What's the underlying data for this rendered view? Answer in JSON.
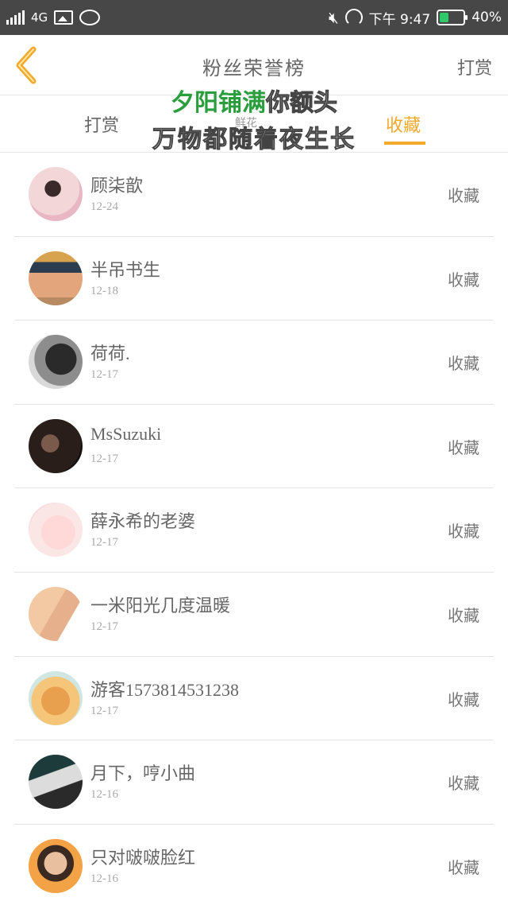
{
  "status_bar": {
    "network": "4G",
    "time": "下午 9:47",
    "battery": "40%",
    "battery_level": 0.4
  },
  "header": {
    "title": "粉丝荣誉榜",
    "action_label": "打赏"
  },
  "tabs": [
    {
      "label": "打赏"
    },
    {
      "label": "鲜花"
    },
    {
      "label": "收藏",
      "active": true
    }
  ],
  "overlay": {
    "line1_green": "夕阳铺满",
    "line1_white": "你额头",
    "line2": "万物都随着夜生长"
  },
  "list": [
    {
      "name": "顾柒歆",
      "date": "12-24",
      "action": "收藏"
    },
    {
      "name": "半吊书生",
      "date": "12-18",
      "action": "收藏"
    },
    {
      "name": "荷荷.",
      "date": "12-17",
      "action": "收藏"
    },
    {
      "name": "MsSuzuki",
      "date": "12-17",
      "action": "收藏"
    },
    {
      "name": "薛永希的老婆",
      "date": "12-17",
      "action": "收藏"
    },
    {
      "name": "一米阳光几度温暖",
      "date": "12-17",
      "action": "收藏"
    },
    {
      "name": "游客1573814531238",
      "date": "12-17",
      "action": "收藏"
    },
    {
      "name": "月下，哼小曲",
      "date": "12-16",
      "action": "收藏"
    },
    {
      "name": "只对啵啵脸红",
      "date": "12-16",
      "action": "收藏"
    }
  ],
  "colors": {
    "accent": "#f2a92c",
    "status_bar": "#474747",
    "battery": "#2fc96a"
  }
}
